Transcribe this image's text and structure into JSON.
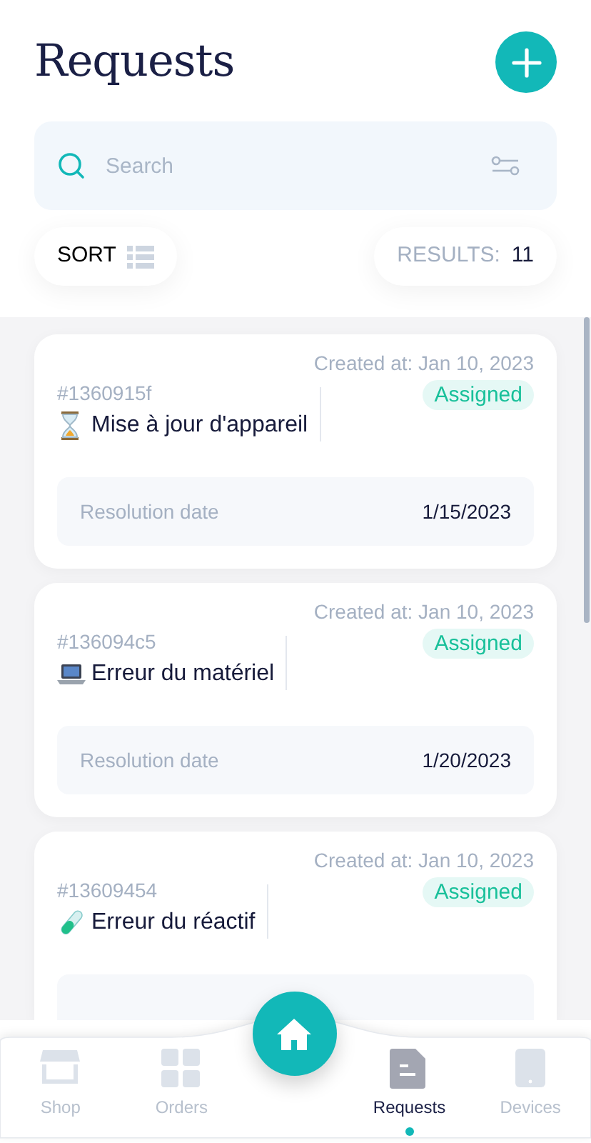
{
  "title": "Requests",
  "search": {
    "placeholder": "Search"
  },
  "sort": {
    "label": "SORT"
  },
  "results": {
    "label": "RESULTS:",
    "count": "11"
  },
  "requests": [
    {
      "created": "Created at: Jan 10, 2023",
      "id": "#1360915f",
      "kind": "hourglass",
      "name": "Mise à jour d'appareil",
      "status": "Assigned",
      "resolution_label": "Resolution date",
      "resolution_date": "1/15/2023"
    },
    {
      "created": "Created at: Jan 10, 2023",
      "id": "#136094c5",
      "kind": "laptop",
      "name": "Erreur du matériel",
      "status": "Assigned",
      "resolution_label": "Resolution date",
      "resolution_date": "1/20/2023"
    },
    {
      "created": "Created at: Jan 10, 2023",
      "id": "#13609454",
      "kind": "tube",
      "name": "Erreur du réactif",
      "status": "Assigned"
    }
  ],
  "nav": [
    {
      "label": "Shop",
      "kind": "shop",
      "selected": false
    },
    {
      "label": "Orders",
      "kind": "grid",
      "selected": false
    },
    {
      "kind": "home"
    },
    {
      "label": "Requests",
      "kind": "doc",
      "selected": true
    },
    {
      "label": "Devices",
      "kind": "device",
      "selected": false
    }
  ]
}
